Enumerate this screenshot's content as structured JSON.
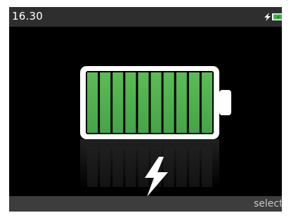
{
  "status_bar": {
    "time": "16.30",
    "icons": [
      "charging-bolt-icon",
      "battery-status-icon"
    ]
  },
  "main": {
    "battery_icon": "battery-icon",
    "charge_fraction": 1.0,
    "segment_count": 10,
    "charging_icon": "charging-bolt-icon"
  },
  "bottom_bar": {
    "select_label": "select"
  },
  "colors": {
    "status_bar_bg": "#2e2e2e",
    "screen_bg": "#000000",
    "battery_outline": "#ffffff",
    "battery_fill": "#4eb051",
    "bottom_bar_bg": "#3d3d3d",
    "bolt": "#ffffff"
  }
}
